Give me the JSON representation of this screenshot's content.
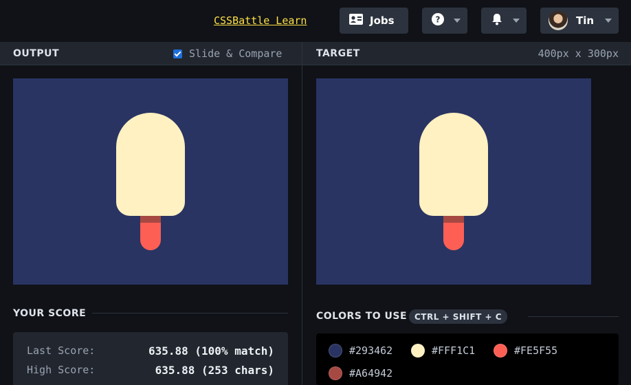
{
  "header": {
    "learn_link": "CSSBattle Learn",
    "jobs_label": "Jobs",
    "user_name": "Tin"
  },
  "output_pane": {
    "title": "OUTPUT",
    "compare_label": "Slide & Compare",
    "compare_checked": true
  },
  "target_pane": {
    "title": "TARGET",
    "dimensions": "400px x 300px"
  },
  "art": {
    "background": "#293462",
    "popsicle": "#FFF1C1",
    "band": "#A64942",
    "stick": "#FE5F55"
  },
  "score": {
    "title": "YOUR SCORE",
    "last_label": "Last Score:",
    "last_value": "635.88 (100% match)",
    "high_label": "High Score:",
    "high_value": "635.88 (253 chars)"
  },
  "colors": {
    "title": "COLORS TO USE",
    "shortcut": "CTRL + SHIFT + C",
    "list": [
      {
        "hex": "#293462"
      },
      {
        "hex": "#FFF1C1"
      },
      {
        "hex": "#FE5F55"
      },
      {
        "hex": "#A64942"
      }
    ]
  }
}
